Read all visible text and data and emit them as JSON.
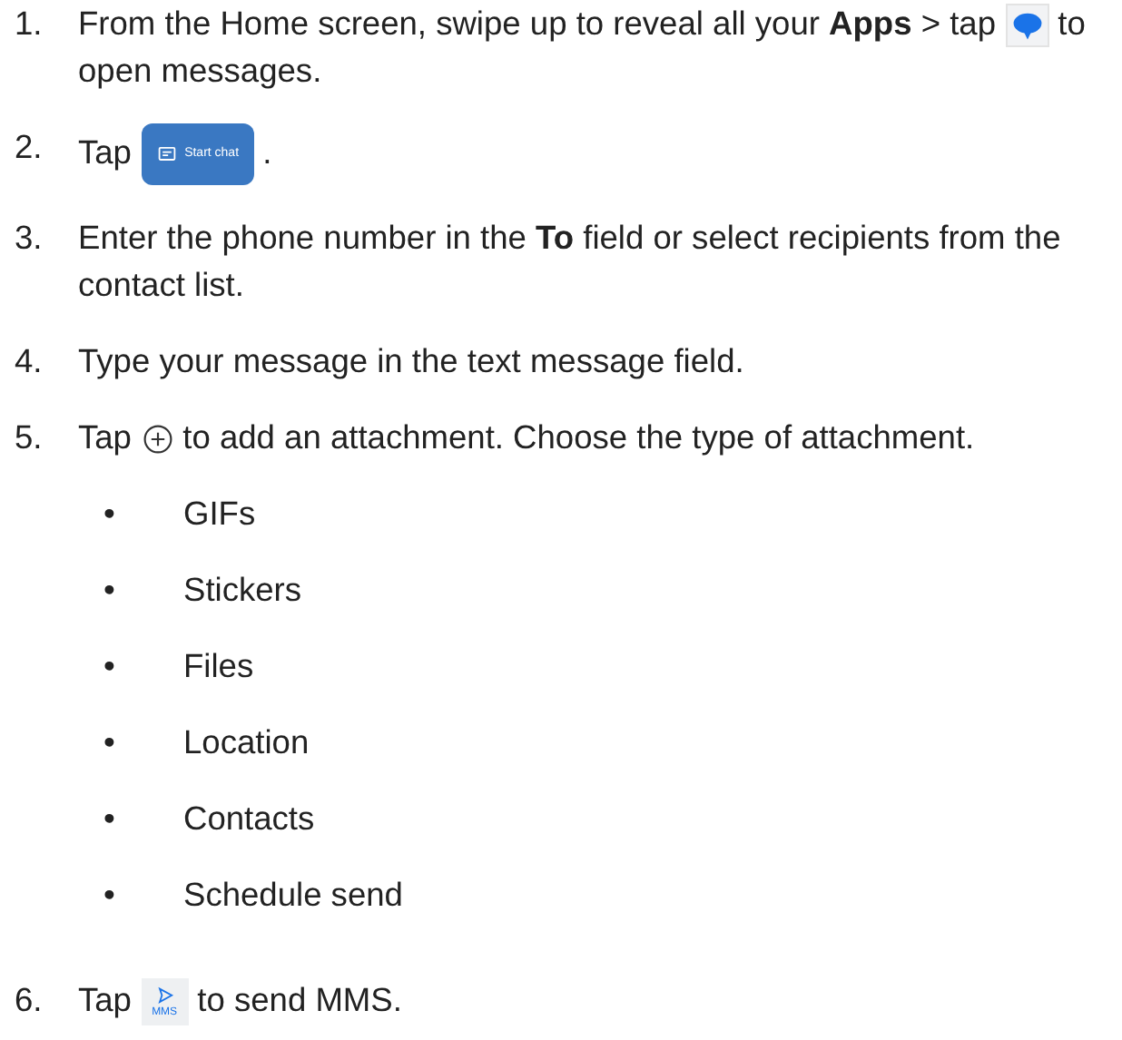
{
  "steps": [
    {
      "number": "1.",
      "parts": [
        {
          "kind": "text",
          "text": "From the Home screen, swipe up to reveal all your **Apps** > tap "
        },
        {
          "kind": "app-icon"
        },
        {
          "kind": "text",
          "text": " to open messages."
        }
      ]
    },
    {
      "number": "2.",
      "parts": [
        {
          "kind": "text",
          "text": "Tap "
        },
        {
          "kind": "button",
          "label": "Start chat"
        },
        {
          "kind": "text",
          "text": " ."
        }
      ]
    },
    {
      "number": "3.",
      "parts": [
        {
          "kind": "text",
          "text": "Enter the phone number in the **To** field or select recipients from the contact list."
        }
      ]
    },
    {
      "number": "4.",
      "parts": [
        {
          "kind": "text",
          "text": "Type your message in the text message field."
        }
      ]
    },
    {
      "number": "5.",
      "parts": [
        {
          "kind": "text",
          "text": "Tap "
        },
        {
          "kind": "add-icon"
        },
        {
          "kind": "text",
          "text": " to add an attachment. Choose the type of attachment."
        }
      ],
      "bullets": [
        {
          "marker": "•",
          "text": "GIFs"
        },
        {
          "marker": "•",
          "text": "Stickers"
        },
        {
          "marker": "•",
          "text": "Files"
        },
        {
          "marker": "•",
          "text": "Location"
        },
        {
          "marker": "•",
          "text": "Contacts"
        },
        {
          "marker": "•",
          "text": "Schedule send"
        }
      ]
    },
    {
      "number": "6.",
      "parts": [
        {
          "kind": "text",
          "text": "Tap "
        },
        {
          "kind": "send",
          "label": "MMS"
        },
        {
          "kind": "text",
          "text": " to send MMS."
        }
      ]
    }
  ]
}
